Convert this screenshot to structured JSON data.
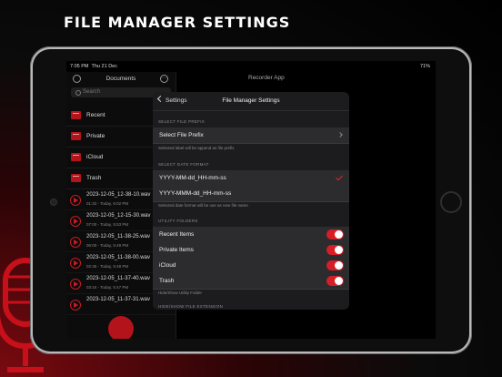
{
  "headline": "FILE MANAGER SETTINGS",
  "status": {
    "time": "7:05 PM",
    "date": "Thu 21 Dec",
    "battery": "71%"
  },
  "sidebar": {
    "title": "Documents",
    "search_placeholder": "Search",
    "folders": [
      {
        "label": "Recent"
      },
      {
        "label": "Private"
      },
      {
        "label": "iCloud"
      },
      {
        "label": "Trash"
      }
    ],
    "recordings": [
      {
        "name": "2023-12-05_12-38-10.wav",
        "meta": "01:32 - Today, 6:02 PM"
      },
      {
        "name": "2023-12-05_12-15-30.wav",
        "meta": "07:00 - Today, 5:53 PM"
      },
      {
        "name": "2023-12-05_11-38-25.wav",
        "meta": "06:00 - Today, 5:49 PM"
      },
      {
        "name": "2023-12-05_11-38-00.wav",
        "meta": "02:45 - Today, 5:48 PM"
      },
      {
        "name": "2023-12-05_11-37-40.wav",
        "meta": "03:16 - Today, 5:47 PM"
      },
      {
        "name": "2023-12-05_11-37-31.wav",
        "meta": ""
      }
    ]
  },
  "main": {
    "title": "Recorder App"
  },
  "modal": {
    "back_label": "Settings",
    "title": "File Manager Settings",
    "prefix_section": "SELECT FILE PREFIX",
    "prefix_row": "Select File Prefix",
    "prefix_footer": "Selected label will be append as file prefix",
    "date_section": "SELECT DATE FORMAT",
    "date_options": [
      {
        "label": "YYYY-MM-dd_HH-mm-ss",
        "selected": true
      },
      {
        "label": "YYYY-MMM-dd_HH-mm-ss",
        "selected": false
      }
    ],
    "date_footer": "Selected date format will be use as new file name",
    "utility_section": "UTILITY FOLDERS",
    "utility_items": [
      {
        "label": "Recent Items",
        "on": true
      },
      {
        "label": "Private Items",
        "on": true
      },
      {
        "label": "iCloud",
        "on": true
      },
      {
        "label": "Trash",
        "on": true
      }
    ],
    "utility_footer": "Hide/Show Utility Folder",
    "extension_section": "HIDE/SHOW FILE EXTENSION"
  },
  "colors": {
    "accent": "#d61e26",
    "background": "#000000"
  }
}
